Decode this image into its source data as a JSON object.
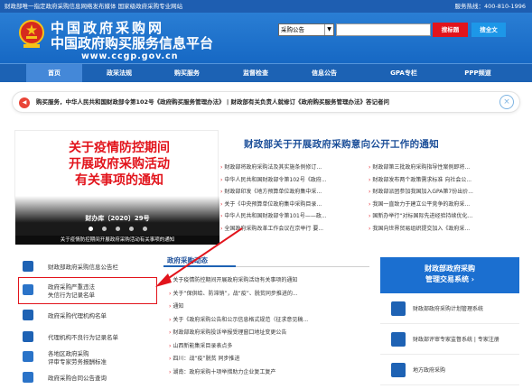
{
  "topbar": {
    "left": "财政部唯一指定政府采购信息网络发布媒体  国家级政府采购专业网站",
    "right": "服务热线：400-810-1996"
  },
  "logo": {
    "title": "中国政府采购网",
    "subtitle": "中国政府购买服务信息平台",
    "url": "www.ccgp.gov.cn"
  },
  "search": {
    "category": "采购公告",
    "value": "",
    "button": "搜标题",
    "fulltext_button": "搜全文"
  },
  "nav": {
    "items": [
      "首页",
      "政采法规",
      "购买服务",
      "监督检查",
      "信息公告",
      "GPA专栏",
      "PPP频道"
    ]
  },
  "notice": {
    "text": "购买服务，中华人民共和国财政部令第102号《政府购买服务管理办法》  |  财政部有关负责人就修订《政府购买服务管理办法》答记者问"
  },
  "banner": {
    "title_lines": [
      "关于疫情防控期间",
      "开展政府采购活动",
      "有关事项的通知"
    ],
    "doc_number": "财办库〔2020〕29号",
    "caption": "关于疫情防控期间开展政府采购活动有关事项的通知",
    "slides": 5,
    "active_slide": 1
  },
  "headline": "财政部关于开展政府采购意向公开工作的通知",
  "news_left": [
    "财政部将政府采购法及其实施条例修订...",
    "中华人民共和国财政部令第102号《政府...",
    "财政部印发《地方预算单位政府集中采...",
    "关于《中央预算单位政府集中采购目录...",
    "中华人民共和国财政部令第101号——政...",
    "全国政府采购改革工作会议在京举行 要..."
  ],
  "news_right": [
    "财政部第三批政府采购指导性案例即将...",
    "财政部发布两个政策需求标准 向社会公...",
    "财政部派团参加我国加入GPA第7份出价...",
    "我国一直致力于建立公平竞争的政府采...",
    "国新办举行“对标国际先进经验持续优化...",
    "我国向世界贸易组织提交加入《政府采..."
  ],
  "sidebar": {
    "items": [
      {
        "lines": [
          "财政部政府采购信息公告栏"
        ]
      },
      {
        "lines": [
          "政府采购严重违法",
          "失信行为记录名单"
        ]
      },
      {
        "lines": [
          "政府采购代理机构名单"
        ]
      },
      {
        "lines": [
          "代理机构不良行为记录名单"
        ]
      },
      {
        "lines": [
          "各地区政府采购",
          "评审专家劳务报酬标准"
        ]
      },
      {
        "lines": [
          "政府采购合同公告查询"
        ]
      }
    ]
  },
  "dynamic": {
    "title": "政府采购动态",
    "items": [
      "关于疫情防控期间开展政府采购活动有关事项的通知",
      "关于“保供给、防滞销”，战“疫”、脱贫同步推进的...",
      "通知",
      "关于《政府采购公告和公示信息格式规范（征求意见稿...",
      "财政部政府采购投诉举报受理窗口地址变更公告",
      "山西新能集采目录表点多",
      "四川：战“疫”脱贫 同步推进",
      "湖南：政府采购十项举措助力企业复工复产"
    ]
  },
  "right_panel": {
    "title_lines": [
      "财政部政府采购",
      "管理交易系统 ›"
    ],
    "rows": [
      "财政部政府采购计划管理系统",
      "财政部评审专家监督系统  |  专家注册",
      "地方政府采购"
    ]
  },
  "colors": {
    "brand_blue": "#1e5eb1",
    "accent_red": "#e2141c",
    "nav_blue": "#1c62b4"
  }
}
